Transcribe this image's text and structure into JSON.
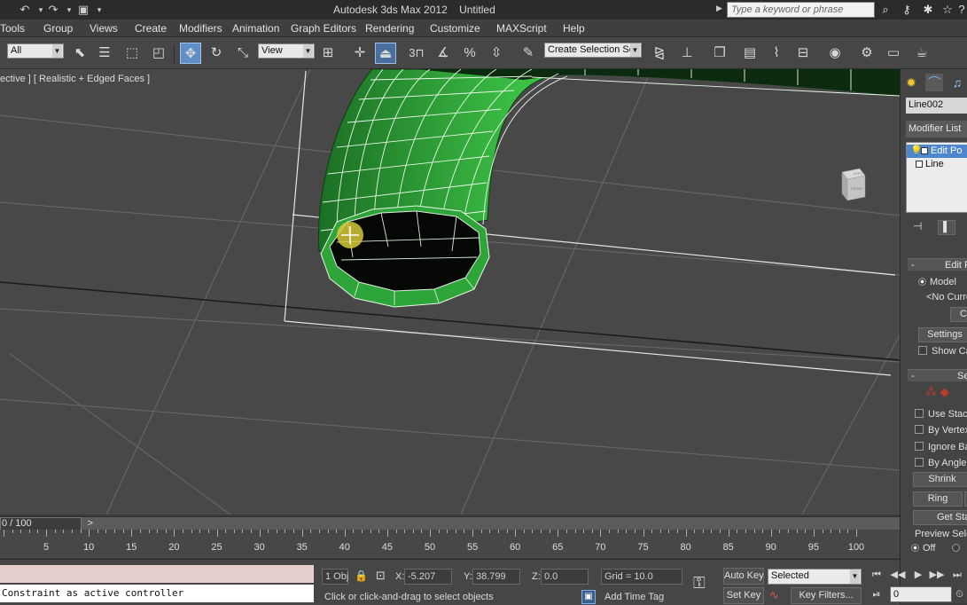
{
  "title_bar": {
    "app_title": "Autodesk 3ds Max 2012",
    "document": "Untitled",
    "search_placeholder": "Type a keyword or phrase"
  },
  "menu": [
    "Tools",
    "Group",
    "Views",
    "Create",
    "Modifiers",
    "Animation",
    "Graph Editors",
    "Rendering",
    "Customize",
    "MAXScript",
    "Help"
  ],
  "toolbar": {
    "selection_filter": "All",
    "ref_coord": "View",
    "named_selection": "Create Selection Se",
    "snap_3": "3"
  },
  "viewport": {
    "label": "ective ] [ Realistic + Edged Faces ]",
    "viewcube_top": "LEFT",
    "viewcube_side": "FRONT",
    "object_color": "#2fa83a"
  },
  "command_panel": {
    "object_name": "Line002",
    "modifier_list": "Modifier List",
    "stack": [
      "Edit Po",
      "Line"
    ],
    "edit_rollout": "Edit P",
    "model_radio": "Model",
    "no_current": "<No Curre",
    "settings_button": "Settings",
    "show_cage": "Show Ca",
    "selection_rollout": "Se",
    "use_stack": "Use Stack",
    "by_vertex": "By Vertex",
    "ignore_back": "Ignore Ba",
    "by_angle": "By Angle",
    "shrink_button": "Shrink",
    "ring_button": "Ring",
    "get_stack_button": "Get Stac",
    "preview_selection": "Preview Selec",
    "off_radio": "Off"
  },
  "timeline": {
    "frame_label": "0 / 100",
    "next_arrow": ">",
    "ticks": [
      "5",
      "10",
      "15",
      "20",
      "25",
      "30",
      "35",
      "40",
      "45",
      "50",
      "55",
      "60",
      "65",
      "70",
      "75",
      "80",
      "85",
      "90",
      "95",
      "100"
    ]
  },
  "status_bar": {
    "listener_output": "Constraint as active controller",
    "objects_selected": "1 Obj",
    "x_label": "X:",
    "x_value": "-5.207",
    "y_label": "Y:",
    "y_value": "38.799",
    "z_label": "Z:",
    "z_value": "0.0",
    "grid": "Grid = 10.0",
    "prompt": "Click or click-and-drag to select objects",
    "add_time_tag": "Add Time Tag",
    "auto_key": "Auto Key",
    "key_mode": "Selected",
    "set_key": "Set Key",
    "key_filters": "Key Filters...",
    "current_frame": "0"
  }
}
